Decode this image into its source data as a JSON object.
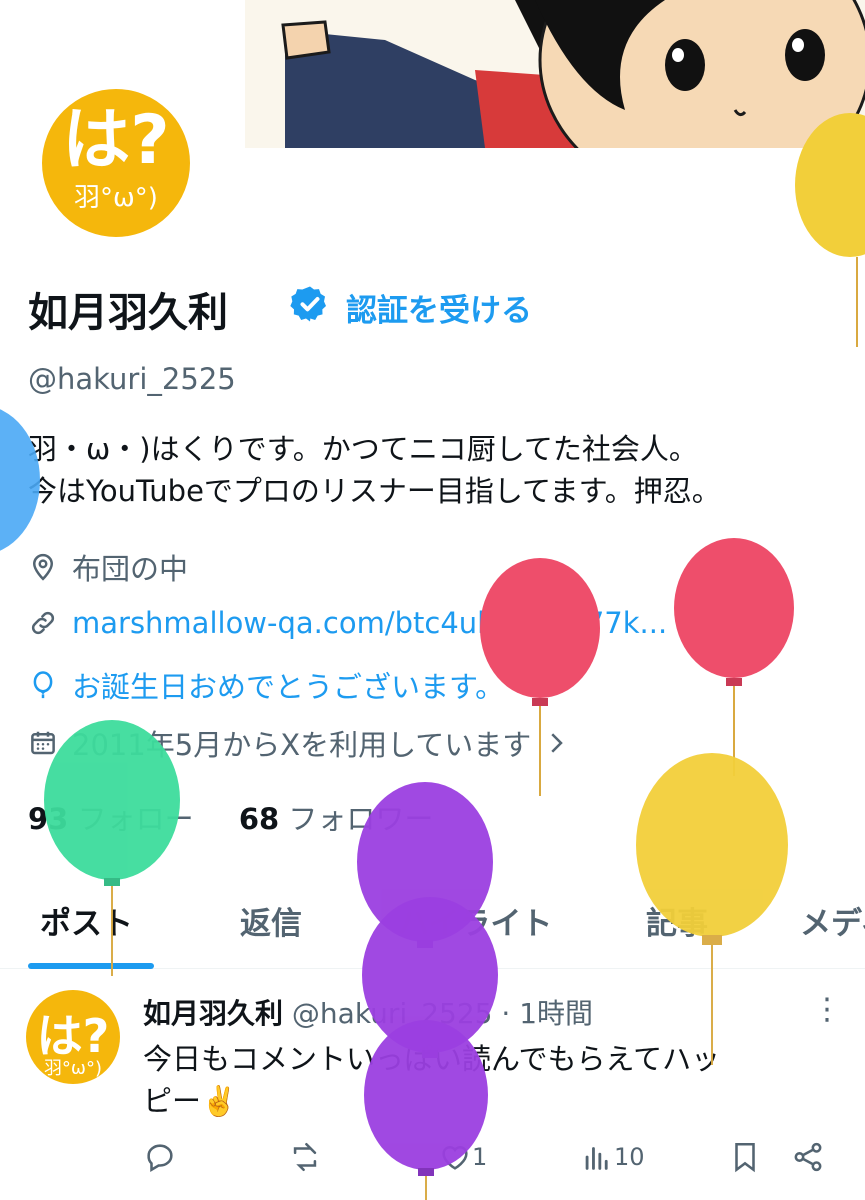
{
  "profile": {
    "name": "如月羽久利",
    "get_verified": "認証を受ける",
    "handle": "@hakuri_2525",
    "bio": [
      "羽・ω・)はくりです。かつてニコ厨してた社会人。",
      "今はYouTubeでプロのリスナー目指してます。押忍。"
    ],
    "location": "布団の中",
    "website": "marshmallow-qa.com/btc4ubv79a377k...",
    "birthday": "お誕生日おめでとうございます。",
    "joined": "2011年5月からXを利用しています",
    "following_count": "93",
    "following_label": "フォロー",
    "followers_count": "68",
    "followers_label": "フォロワー",
    "avatar_text": "は?",
    "avatar_sub": "羽°ω°)"
  },
  "tabs": [
    "ポスト",
    "返信",
    "ハイライト",
    "記事",
    "メディ"
  ],
  "post": {
    "author": "如月羽久利",
    "handle": "@hakuri_2525",
    "time": "· 1時間",
    "text": [
      "今日もコメントいっぱい読んでもらえてハッ",
      "ピー✌️"
    ],
    "likes": "1",
    "views": "10"
  },
  "colors": {
    "accent": "#1d9bf0",
    "avatar_bg": "#f5b70c"
  },
  "icons": [
    "verified-badge-icon",
    "location-icon",
    "link-icon",
    "balloon-icon",
    "calendar-icon",
    "chevron-right-icon",
    "reply-icon",
    "repost-icon",
    "like-icon",
    "views-icon",
    "bookmark-icon",
    "share-icon",
    "more-icon"
  ]
}
